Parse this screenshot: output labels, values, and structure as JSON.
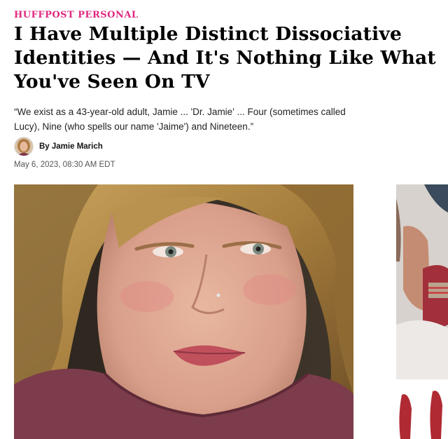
{
  "article": {
    "kicker": "HUFFPOST PERSONAL",
    "headline_lines": [
      "I Have Multiple Distinct Dissociative",
      "Identities — And It's Nothing Like What",
      "You've Seen On TV"
    ],
    "dek": "“We exist as a 43-year-old adult, Jamie ... 'Dr. Jamie' ... Four (sometimes called Lucy), Nine (who spells our name 'Jaime') and Nineteen.”",
    "author": "By Jamie Marich",
    "date": "May 6, 2023, 08:30 AM EDT"
  },
  "colors": {
    "kicker": "#e0287f",
    "headline": "#000000",
    "body_text": "#222222",
    "date_text": "#555555"
  }
}
